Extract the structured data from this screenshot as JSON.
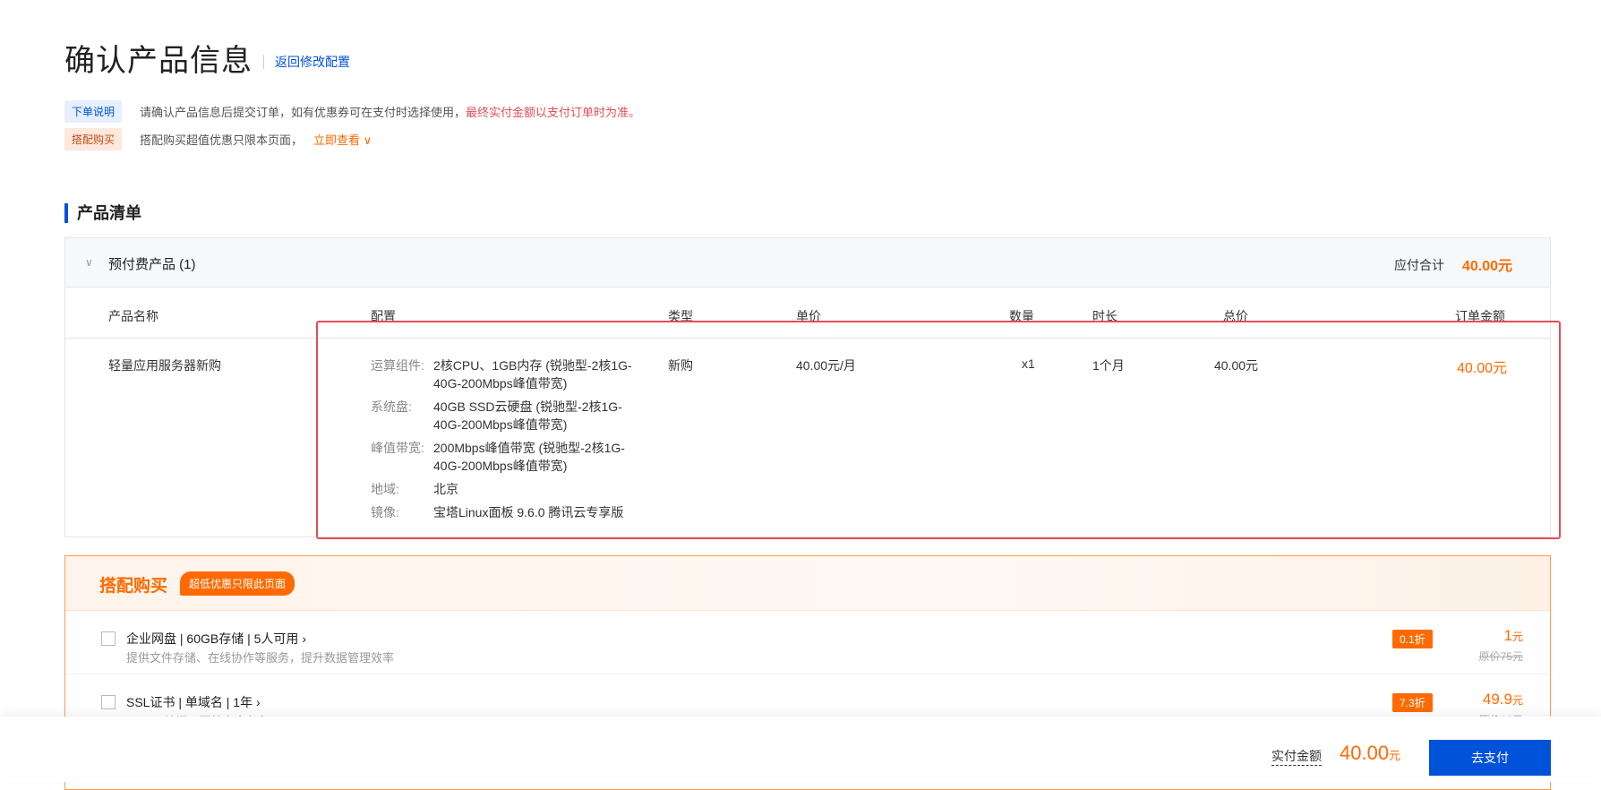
{
  "header": {
    "title": "确认产品信息",
    "back_link": "返回修改配置"
  },
  "notices": [
    {
      "tag": "下单说明",
      "text": "请确认产品信息后提交订单，如有优惠券可在支付时选择使用，",
      "highlight": "最终实付金额以支付订单时为准。"
    },
    {
      "tag": "搭配购买",
      "text": "搭配购买超值优惠只限本页面，",
      "link": "立即查看"
    }
  ],
  "section_title": "产品清单",
  "group": {
    "name": "预付费产品 (1)",
    "due_label": "应付合计",
    "due_value": "40.00元"
  },
  "columns": [
    "产品名称",
    "配置",
    "类型",
    "单价",
    "数量",
    "时长",
    "总价",
    "订单金额"
  ],
  "product": {
    "name": "轻量应用服务器新购",
    "config": [
      {
        "key": "运算组件:",
        "value": "2核CPU、1GB内存 (锐驰型-2核1G-40G-200Mbps峰值带宽)"
      },
      {
        "key": "系统盘:",
        "value": "40GB SSD云硬盘 (锐驰型-2核1G-40G-200Mbps峰值带宽)"
      },
      {
        "key": "峰值带宽:",
        "value": "200Mbps峰值带宽 (锐驰型-2核1G-40G-200Mbps峰值带宽)"
      },
      {
        "key": "地域:",
        "value": "北京"
      },
      {
        "key": "镜像:",
        "value": "宝塔Linux面板 9.6.0 腾讯云专享版"
      }
    ],
    "type": "新购",
    "unit_price": "40.00元/月",
    "quantity": "x1",
    "duration": "1个月",
    "total": "40.00元",
    "order_amount": "40.00元"
  },
  "bundle": {
    "title": "搭配购买",
    "badge": "超低优惠只限此页面",
    "items": [
      {
        "name": "企业网盘 | 60GB存储 | 5人可用",
        "desc": "提供文件存储、在线协作等服务，提升数据管理效率",
        "discount": "0.1折",
        "price": "1",
        "unit": "元",
        "orig": "原价75元"
      },
      {
        "name": "SSL证书 | 单域名 | 1年",
        "desc": "HTTPS访问，网站安全必备",
        "discount": "7.3折",
        "price": "49.9",
        "unit": "元",
        "orig": "原价68元"
      }
    ]
  },
  "footer": {
    "pay_label": "实付金额",
    "pay_amount": "40.00",
    "pay_unit": "元",
    "pay_button": "去支付"
  },
  "colors": {
    "accent": "#0052d9",
    "orange": "#ff6a00",
    "highlight_red": "#e34d59"
  }
}
